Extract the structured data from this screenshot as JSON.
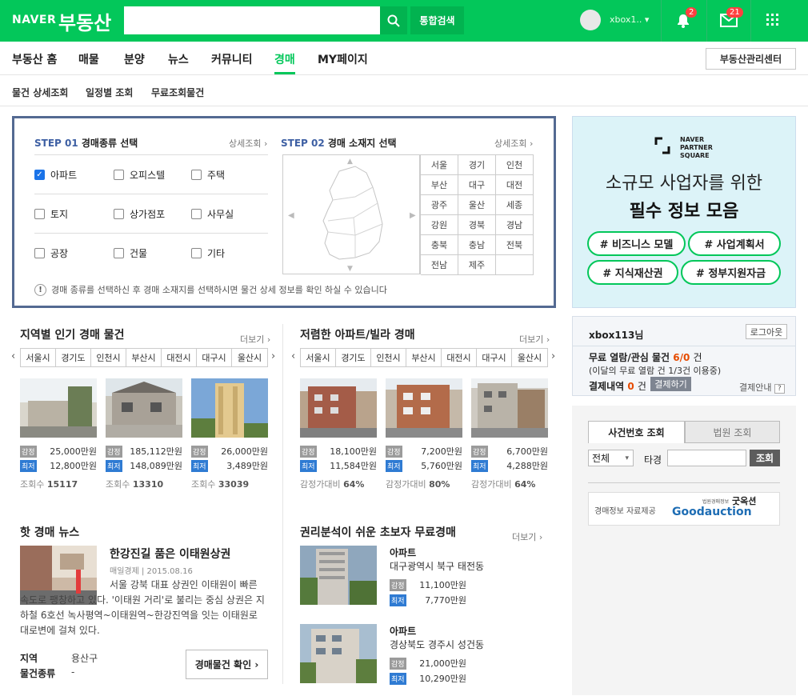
{
  "header": {
    "logo_naver": "NAVER",
    "logo_service": "부동산",
    "search_placeholder": "",
    "total_search": "통합검색",
    "user": "xbox1..",
    "notify_count": "2",
    "mail_count": "21"
  },
  "gnb": {
    "items": [
      "부동산 홈",
      "매물",
      "분양",
      "뉴스",
      "커뮤니티",
      "경매",
      "MY페이지"
    ],
    "active": "경매",
    "manager_center": "부동산관리센터"
  },
  "lnb": {
    "items": [
      "물건 상세조회",
      "일정별 조회",
      "무료조회물건"
    ]
  },
  "step1": {
    "num": "STEP 01",
    "title": "경매종류 선택",
    "more": "상세조회",
    "types": [
      {
        "label": "아파트",
        "checked": true
      },
      {
        "label": "오피스텔",
        "checked": false
      },
      {
        "label": "주택",
        "checked": false
      },
      {
        "label": "토지",
        "checked": false
      },
      {
        "label": "상가점포",
        "checked": false
      },
      {
        "label": "사무실",
        "checked": false
      },
      {
        "label": "공장",
        "checked": false
      },
      {
        "label": "건물",
        "checked": false
      },
      {
        "label": "기타",
        "checked": false
      }
    ]
  },
  "step2": {
    "num": "STEP 02",
    "title": "경매 소재지 선택",
    "more": "상세조회",
    "regions": [
      "서울",
      "경기",
      "인천",
      "부산",
      "대구",
      "대전",
      "광주",
      "울산",
      "세종",
      "강원",
      "경북",
      "경남",
      "충북",
      "충남",
      "전북",
      "전남",
      "제주",
      ""
    ]
  },
  "step_note": "경매 종류를 선택하신 후 경매 소재지를 선택하시면 물건 상세 정보를 확인 하실 수 있습니다",
  "popular": {
    "title": "지역별 인기 경매 물건",
    "more": "더보기",
    "tabs": [
      "서울시",
      "경기도",
      "인천시",
      "부산시",
      "대전시",
      "대구시",
      "울산시"
    ],
    "items": [
      {
        "appraisal": "25,000만원",
        "minimum": "12,800만원",
        "views_label": "조회수",
        "views": "15117"
      },
      {
        "appraisal": "185,112만원",
        "minimum": "148,089만원",
        "views_label": "조회수",
        "views": "13310"
      },
      {
        "appraisal": "26,000만원",
        "minimum": "3,489만원",
        "views_label": "조회수",
        "views": "33039"
      }
    ]
  },
  "cheap": {
    "title": "저렴한 아파트/빌라 경매",
    "more": "더보기",
    "tabs": [
      "서울시",
      "경기도",
      "인천시",
      "부산시",
      "대전시",
      "대구시",
      "울산시"
    ],
    "items": [
      {
        "appraisal": "18,100만원",
        "minimum": "11,584만원",
        "ratio_label": "감정가대비",
        "ratio": "64%"
      },
      {
        "appraisal": "7,200만원",
        "minimum": "5,760만원",
        "ratio_label": "감정가대비",
        "ratio": "80%"
      },
      {
        "appraisal": "6,700만원",
        "minimum": "4,288만원",
        "ratio_label": "감정가대비",
        "ratio": "64%"
      }
    ]
  },
  "tags": {
    "appraisal": "감정",
    "minimum": "최저"
  },
  "news": {
    "title": "핫 경매 뉴스",
    "headline": "한강진길 품은 이태원상권",
    "source": "매일경제",
    "date": "2015.08.16",
    "body": "서울 강북 대표 상권인 이태원이 빠른 속도로 팽창하고 있다. '이태원 거리'로 불리는 중심 상권은 지하철 6호선 녹사평역~이태원역~한강진역을 잇는 이태원로 대로변에 걸쳐 있다.",
    "region_label": "지역",
    "region": "용산구",
    "type_label": "물건종류",
    "type": "-",
    "button": "경매물건 확인"
  },
  "beginner": {
    "title": "권리분석이 쉬운 초보자 무료경매",
    "more": "더보기",
    "items": [
      {
        "type": "아파트",
        "address": "대구광역시 북구 태전동",
        "appraisal": "11,100만원",
        "minimum": "7,770만원"
      },
      {
        "type": "아파트",
        "address": "경상북도 경주시 성건동",
        "appraisal": "21,000만원",
        "minimum": "10,290만원"
      }
    ]
  },
  "ad": {
    "brand": "NAVER PARTNER SQUARE",
    "line1": "소규모 사업자를 위한",
    "line2": "필수 정보 모음",
    "hashtags": [
      "# 비즈니스 모델",
      "# 사업계획서",
      "# 지식재산권",
      "# 정부지원자금"
    ]
  },
  "login": {
    "user": "xbox113님",
    "logout": "로그아웃",
    "free_label": "무료 열람/관심 물건",
    "free_count": "6/0",
    "free_unit": "건",
    "free_note": "(이달의 무료 열람 건 1/3건 이용중)",
    "pay_label": "결제내역",
    "pay_count": "0",
    "pay_unit": "건",
    "pay_button": "결제하기",
    "pay_guide": "결제안내"
  },
  "case_search": {
    "tab_case": "사건번호 조회",
    "tab_court": "법원 조회",
    "select": "전체",
    "label": "타경",
    "button": "조회",
    "provider_label": "경매정보 자료제공",
    "provider_sub": "법원경매정보",
    "provider_kor": "굿옥션",
    "provider_name": "Goodauction"
  },
  "colors": {
    "brand": "#03c75a",
    "step_border": "#546a92",
    "tag_min": "#2f7bd3",
    "tag_apr": "#9b9b9b",
    "accent_red": "#e64b00"
  }
}
